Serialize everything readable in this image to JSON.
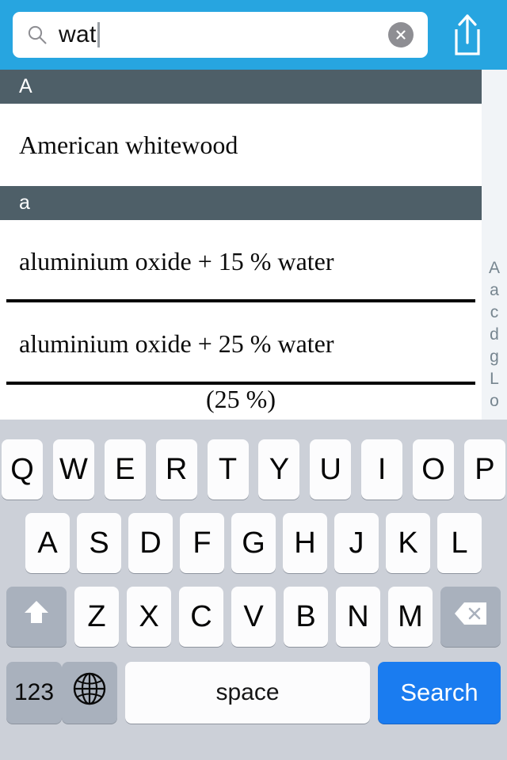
{
  "search": {
    "value": "wat",
    "placeholder": "Search",
    "search_icon": "search-icon",
    "clear_icon": "clear-circle-icon",
    "share_icon": "share-icon",
    "accent_color": "#27a5e0"
  },
  "results": {
    "sections": [
      {
        "header": "A",
        "rows": [
          {
            "text": "American whitewood",
            "divider": false
          }
        ]
      },
      {
        "header": "a",
        "rows": [
          {
            "text": "aluminium oxide + 15 % water",
            "divider": true
          },
          {
            "text": "aluminium oxide + 25 % water",
            "divider": true
          },
          {
            "text": "(25 %)",
            "divider": false
          }
        ]
      }
    ],
    "header_color": "#4e5f68"
  },
  "index_strip": {
    "letters": [
      "A",
      "a",
      "c",
      "d",
      "g",
      "L",
      "o"
    ]
  },
  "keyboard": {
    "row1": [
      "Q",
      "W",
      "E",
      "R",
      "T",
      "Y",
      "U",
      "I",
      "O",
      "P"
    ],
    "row2": [
      "A",
      "S",
      "D",
      "F",
      "G",
      "H",
      "J",
      "K",
      "L"
    ],
    "row3": [
      "Z",
      "X",
      "C",
      "V",
      "B",
      "N",
      "M"
    ],
    "shift_icon": "shift-icon",
    "backspace_icon": "backspace-icon",
    "numbers_label": "123",
    "globe_icon": "globe-icon",
    "space_label": "space",
    "search_label": "Search",
    "search_key_color": "#1a7cf0"
  }
}
